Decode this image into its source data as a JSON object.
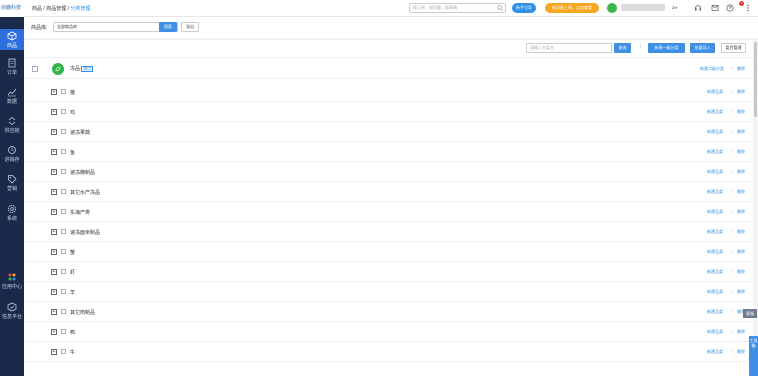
{
  "brand": {
    "name": "尚鹿科技"
  },
  "sidebar": {
    "items": [
      {
        "label": "商品",
        "icon": "cube-icon"
      },
      {
        "label": "订单",
        "icon": "order-icon"
      },
      {
        "label": "数据",
        "icon": "chart-line-icon"
      },
      {
        "label": "供应链",
        "icon": "supply-chain-icon"
      },
      {
        "label": "进销存",
        "icon": "inventory-icon"
      },
      {
        "label": "营销",
        "icon": "tag-icon"
      },
      {
        "label": "系统",
        "icon": "gear-icon"
      },
      {
        "label": "应用中心",
        "icon": "apps-icon"
      },
      {
        "label": "信息平台",
        "icon": "info-platform-icon"
      }
    ]
  },
  "topbar": {
    "breadcrumb": [
      "商品",
      "商品管理",
      "分类管理"
    ],
    "search_placeholder": "搜订单、搜问题、搜草稿",
    "help_label": "新手引导",
    "promo_label": "新功能上线，点击查看",
    "notification_count": "3",
    "lang_label": "ZH"
  },
  "filter": {
    "library_label": "商品库:",
    "library_value": "全部商品库",
    "search_button": "搜索",
    "export_button": "导出"
  },
  "toolbar": {
    "category_placeholder": "请输入分类名",
    "search_button": "查询",
    "new_level1_button": "新建一级分类",
    "batch_import_button": "批量导入",
    "manage_button": "类目管理"
  },
  "root": {
    "name": "冻品",
    "tag": "通用",
    "add_sub_label": "新建二级分类",
    "delete_label": "删除"
  },
  "rows": {
    "action_add": "新建品类",
    "action_delete": "删除",
    "items": [
      "猪",
      "鸡",
      "速冻果蔬",
      "鱼",
      "速冻腌制品",
      "其它水产冻品",
      "东海产类",
      "速冻面米制品",
      "蟹",
      "虾",
      "羊",
      "其它肉制品",
      "鸭",
      "牛"
    ]
  },
  "floating": {
    "side_tag": "客服",
    "side_panel": "工具箱"
  }
}
